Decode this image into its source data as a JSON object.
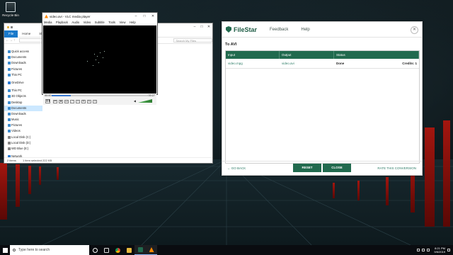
{
  "desktop": {
    "recycle_bin_label": "Recycle Bin"
  },
  "explorer": {
    "tabs": [
      "File",
      "Home",
      "Share",
      "View"
    ],
    "search_placeholder": "Search My Files",
    "nav_items": [
      {
        "label": "Quick access"
      },
      {
        "label": "Documents"
      },
      {
        "label": "Downloads"
      },
      {
        "label": "Pictures"
      },
      {
        "label": "This PC"
      },
      {
        "label": "OneDrive"
      },
      {
        "label": "This PC"
      },
      {
        "label": "3D Objects"
      },
      {
        "label": "Desktop"
      },
      {
        "label": "Documents"
      },
      {
        "label": "Downloads"
      },
      {
        "label": "Music"
      },
      {
        "label": "Pictures"
      },
      {
        "label": "Videos"
      },
      {
        "label": "Local Disk (C:)"
      },
      {
        "label": "Local Disk (D:)"
      },
      {
        "label": "WD Blue (E:)"
      },
      {
        "label": "Network"
      }
    ],
    "status": {
      "items": "2 items",
      "selected": "1 item selected  222 KB"
    }
  },
  "vlc": {
    "title": "video.avi - VLC media player",
    "menu": [
      "Media",
      "Playback",
      "Audio",
      "Video",
      "Subtitle",
      "Tools",
      "View",
      "Help"
    ],
    "time_elapsed": "00:00",
    "time_total": "00:27",
    "progress_fraction": 0.2
  },
  "filestar": {
    "logo_text": "FileStar",
    "nav": [
      "Feedback",
      "Help"
    ],
    "section_title": "To AVI",
    "columns": [
      "Input",
      "Output",
      "Status"
    ],
    "rows": [
      {
        "input": "video.mpg",
        "output": "video.avi",
        "status": "Done",
        "credits": "Credits: 1"
      }
    ],
    "go_back": "GO BACK",
    "reset": "RESET",
    "close": "CLOSE",
    "rate": "RATE THIS CONVERSION"
  },
  "taskbar": {
    "search_placeholder": "Type here to search",
    "time": "8:21 PM",
    "date": "9/6/2019"
  }
}
